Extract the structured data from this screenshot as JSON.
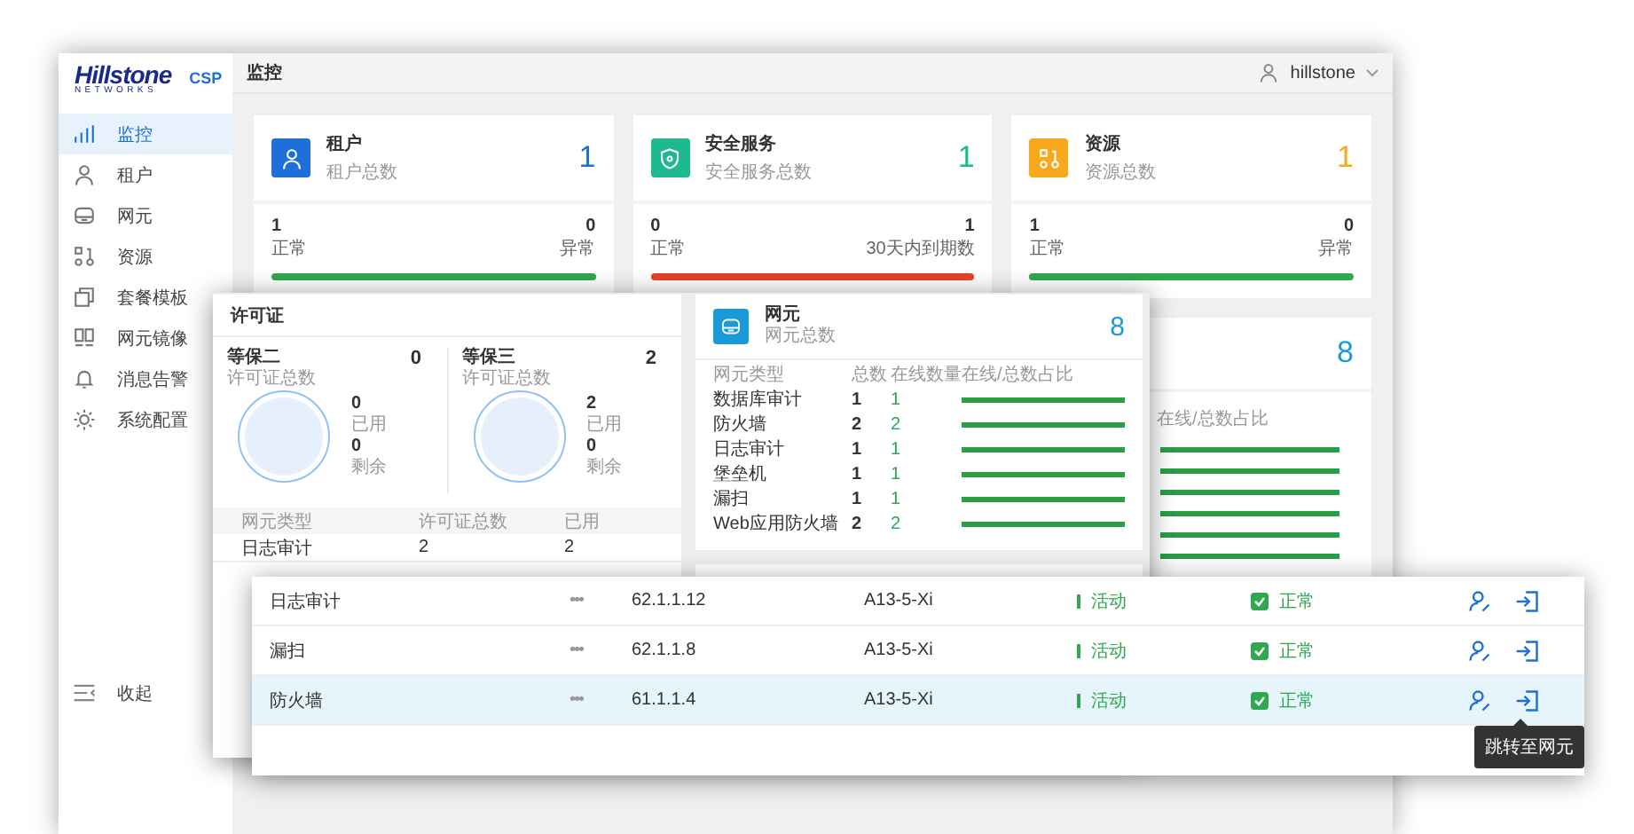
{
  "main_window": {
    "logo": "Hillstone",
    "logo_sub": "NETWORKS",
    "product": "CSP",
    "page_title": "监控",
    "user": "hillstone",
    "sidebar": {
      "items": [
        {
          "label": "监控",
          "selected": true
        },
        {
          "label": "租户",
          "selected": false
        },
        {
          "label": "网元",
          "selected": false
        },
        {
          "label": "资源",
          "selected": false
        },
        {
          "label": "套餐模板",
          "selected": false
        },
        {
          "label": "网元镜像",
          "selected": false
        },
        {
          "label": "消息告警",
          "selected": false
        },
        {
          "label": "系统配置",
          "selected": false
        }
      ],
      "collapse": "收起"
    },
    "summary_cards": [
      {
        "title": "租户",
        "subtitle": "租户总数",
        "count": "1",
        "color": "#1e6fd9",
        "left_value": "1",
        "left_label": "正常",
        "right_value": "0",
        "right_label": "异常",
        "level": 1
      },
      {
        "title": "安全服务",
        "subtitle": "安全服务总数",
        "count": "1",
        "color": "#1dba8f",
        "left_value": "0",
        "left_label": "正常",
        "right_value": "1",
        "right_label": "30天内到期数",
        "level": 0
      },
      {
        "title": "资源",
        "subtitle": "资源总数",
        "count": "1",
        "color": "#f7a81b",
        "left_value": "1",
        "left_label": "正常",
        "right_value": "0",
        "right_label": "异常",
        "level": 1
      }
    ],
    "element_card": {
      "count": "8",
      "ratio_header": "在线/总数占比",
      "bars": [
        {
          "level": 1
        },
        {
          "level": 1
        },
        {
          "level": 1
        },
        {
          "level": 1
        },
        {
          "level": 1
        },
        {
          "level": 1
        }
      ]
    }
  },
  "overview_window": {
    "license": {
      "title": "许可证",
      "tiers": [
        {
          "name": "等保二",
          "subtitle": "许可证总数",
          "total": "0",
          "used": "0",
          "used_label": "已用",
          "remaining": "0",
          "remaining_label": "剩余"
        },
        {
          "name": "等保三",
          "subtitle": "许可证总数",
          "total": "2",
          "used": "2",
          "used_label": "已用",
          "remaining": "0",
          "remaining_label": "剩余"
        }
      ],
      "columns": [
        "网元类型",
        "许可证总数",
        "已用"
      ],
      "rows": [
        [
          "日志审计",
          "2",
          "2"
        ]
      ]
    },
    "elements": {
      "title": "网元",
      "subtitle": "网元总数",
      "count": "8",
      "columns": [
        "网元类型",
        "总数",
        "在线数量",
        "在线/总数占比"
      ],
      "rows": [
        {
          "type": "数据库审计",
          "total": "1",
          "online": "1",
          "level": 1
        },
        {
          "type": "防火墙",
          "total": "2",
          "online": "2",
          "level": 1
        },
        {
          "type": "日志审计",
          "total": "1",
          "online": "1",
          "level": 1
        },
        {
          "type": "堡垒机",
          "total": "1",
          "online": "1",
          "level": 1
        },
        {
          "type": "漏扫",
          "total": "1",
          "online": "1",
          "level": 1
        },
        {
          "type": "Web应用防火墙",
          "total": "2",
          "online": "2",
          "level": 1
        }
      ]
    }
  },
  "device_table": {
    "rows": [
      {
        "name": "日志审计",
        "more": "•••",
        "ip": "62.1.1.12",
        "location": "A13-5-Xi",
        "status": "活动",
        "health": "正常",
        "selected": false
      },
      {
        "name": "漏扫",
        "more": "•••",
        "ip": "62.1.1.8",
        "location": "A13-5-Xi",
        "status": "活动",
        "health": "正常",
        "selected": false
      },
      {
        "name": "防火墙",
        "more": "•••",
        "ip": "61.1.1.4",
        "location": "A13-5-Xi",
        "status": "活动",
        "health": "正常",
        "selected": true
      }
    ]
  },
  "tooltip": "跳转至网元"
}
